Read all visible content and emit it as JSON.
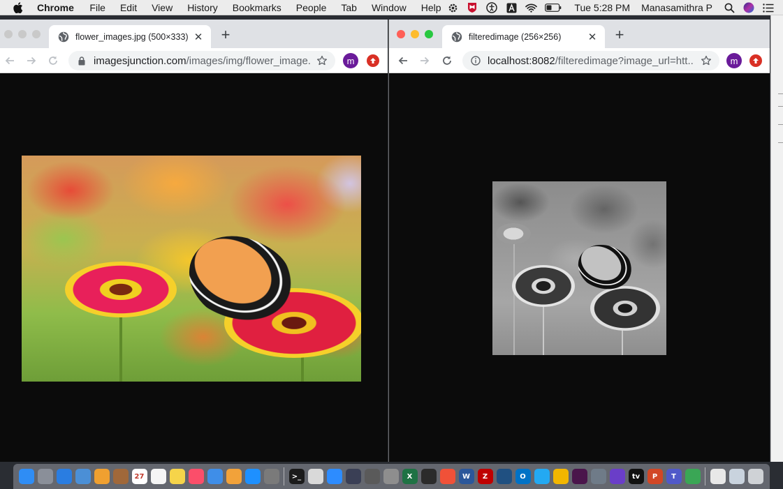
{
  "menubar": {
    "app_name": "Chrome",
    "menus": [
      "File",
      "Edit",
      "View",
      "History",
      "Bookmarks",
      "People",
      "Tab",
      "Window",
      "Help"
    ],
    "clock": "Tue 5:28 PM",
    "user": "Manasamithra P"
  },
  "left_window": {
    "tab_title": "flower_images.jpg (500×333)",
    "url_host": "imagesjunction.com",
    "url_path": "/images/img/flower_image...",
    "avatar_letter": "m"
  },
  "right_window": {
    "tab_title": "filteredimage (256×256)",
    "url_host": "localhost:8082",
    "url_path": "/filteredimage?image_url=htt...",
    "avatar_letter": "m"
  },
  "dock": {
    "icons": [
      {
        "name": "finder-icon",
        "color": "#2f8df5",
        "label": ""
      },
      {
        "name": "launchpad-icon",
        "color": "#8a8f99",
        "label": ""
      },
      {
        "name": "safari-icon",
        "color": "#2a7de1",
        "label": ""
      },
      {
        "name": "preview-icon",
        "color": "#4b8fd6",
        "label": ""
      },
      {
        "name": "photos-icon",
        "color": "#f0a030",
        "label": ""
      },
      {
        "name": "notebook-icon",
        "color": "#a0683a",
        "label": ""
      },
      {
        "name": "calendar-icon",
        "color": "#ffffff",
        "label": "27"
      },
      {
        "name": "reminders-icon",
        "color": "#f5f5f5",
        "label": ""
      },
      {
        "name": "notes-icon",
        "color": "#f6d44a",
        "label": ""
      },
      {
        "name": "music-icon",
        "color": "#fb4e6a",
        "label": ""
      },
      {
        "name": "keynote-icon",
        "color": "#3f8ee8",
        "label": ""
      },
      {
        "name": "pages-icon",
        "color": "#f2a23a",
        "label": ""
      },
      {
        "name": "app-store-icon",
        "color": "#1e90ff",
        "label": ""
      },
      {
        "name": "system-preferences-icon",
        "color": "#7a7a7a",
        "label": ""
      },
      {
        "name": "terminal-icon",
        "color": "#1b1b1b",
        "label": ">_"
      },
      {
        "name": "script-editor-icon",
        "color": "#d9d9d9",
        "label": ""
      },
      {
        "name": "zoom-icon",
        "color": "#2d8cff",
        "label": ""
      },
      {
        "name": "messenger-icon",
        "color": "#3a3f55",
        "label": ""
      },
      {
        "name": "disk-utility-icon",
        "color": "#5a5a5a",
        "label": ""
      },
      {
        "name": "scissors-icon",
        "color": "#8e8e8e",
        "label": ""
      },
      {
        "name": "excel-icon",
        "color": "#1f7244",
        "label": "X"
      },
      {
        "name": "warnings-icon",
        "color": "#2b2b2b",
        "label": ""
      },
      {
        "name": "swift-icon",
        "color": "#f05138",
        "label": ""
      },
      {
        "name": "word-icon",
        "color": "#2b579a",
        "label": "W"
      },
      {
        "name": "filezilla-icon",
        "color": "#bf0000",
        "label": "Z"
      },
      {
        "name": "sourcetree-icon",
        "color": "#205081",
        "label": ""
      },
      {
        "name": "outlook-icon",
        "color": "#0072c6",
        "label": "O"
      },
      {
        "name": "vscode-icon",
        "color": "#23a9f2",
        "label": ""
      },
      {
        "name": "chrome-icon",
        "color": "#f2b600",
        "label": ""
      },
      {
        "name": "slack-icon",
        "color": "#4a154b",
        "label": ""
      },
      {
        "name": "network-icon",
        "color": "#6f7b88",
        "label": ""
      },
      {
        "name": "imovie-icon",
        "color": "#6a3ec8",
        "label": ""
      },
      {
        "name": "apple-tv-icon",
        "color": "#111111",
        "label": "tv"
      },
      {
        "name": "powerpoint-icon",
        "color": "#d24726",
        "label": "P"
      },
      {
        "name": "teams-icon",
        "color": "#5059c9",
        "label": "T"
      },
      {
        "name": "cloud-icon",
        "color": "#3aa655",
        "label": ""
      },
      {
        "name": "document-icon",
        "color": "#e8e8e8",
        "label": ""
      },
      {
        "name": "screen-icon",
        "color": "#c9d3de",
        "label": ""
      },
      {
        "name": "trash-icon",
        "color": "#cfd2d6",
        "label": ""
      }
    ]
  }
}
